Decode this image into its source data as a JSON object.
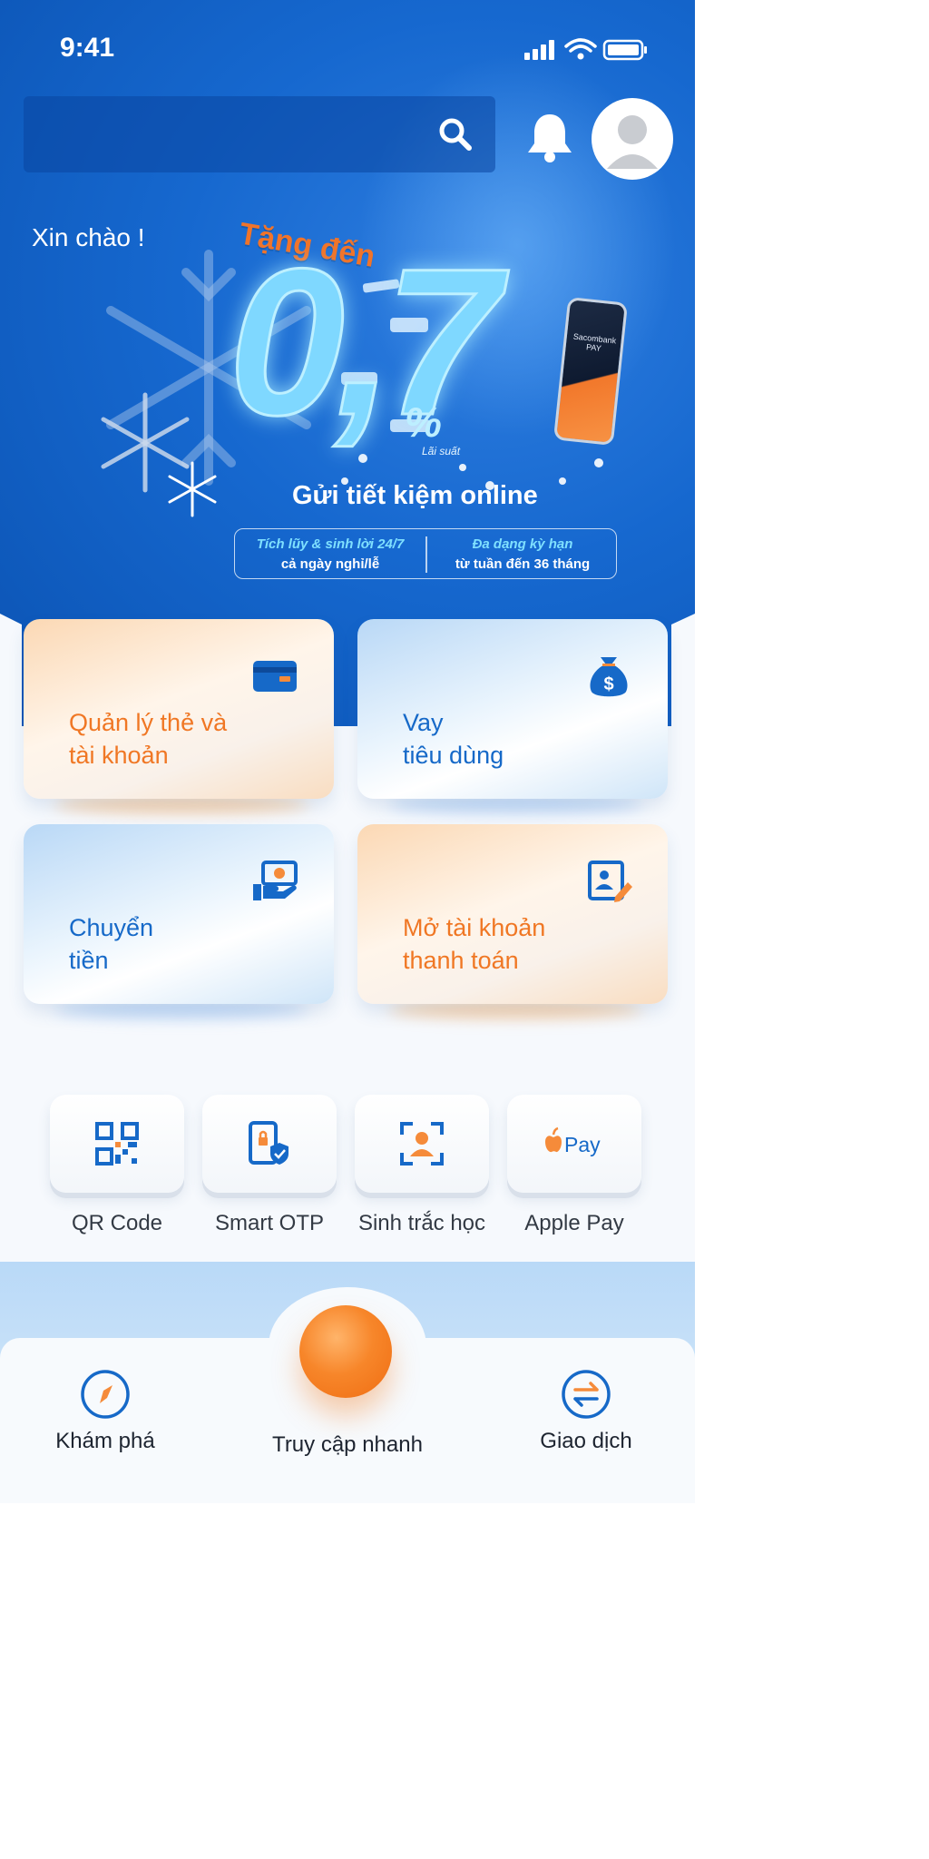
{
  "status_bar": {
    "time": "9:41"
  },
  "header": {
    "greeting": "Xin chào !"
  },
  "banner": {
    "headline": "Tặng đến",
    "rate": "0,7",
    "rate_unit": "%",
    "rate_note": "Lãi suất",
    "title": "Gửi tiết kiệm online",
    "features": [
      {
        "line1": "Tích lũy & sinh lời 24/7",
        "line2": "cả ngày nghỉ/lễ"
      },
      {
        "line1": "Đa dạng kỳ hạn",
        "line2": "từ tuần đến 36 tháng"
      }
    ],
    "phone_label": "Sacombank PAY"
  },
  "cards": [
    {
      "label_line1": "Quản lý thẻ và",
      "label_line2": "tài khoản",
      "icon": "card-icon",
      "color": "#f07724"
    },
    {
      "label_line1": "Vay",
      "label_line2": "tiêu dùng",
      "icon": "money-bag-icon",
      "color": "#1669c8"
    },
    {
      "label_line1": "Chuyển",
      "label_line2": "tiền",
      "icon": "transfer-money-icon",
      "color": "#1669c8"
    },
    {
      "label_line1": "Mở tài khoản",
      "label_line2": "thanh toán",
      "icon": "edit-account-icon",
      "color": "#f07724"
    }
  ],
  "quick_actions": [
    {
      "label": "QR Code",
      "icon": "qr-code-icon"
    },
    {
      "label": "Smart OTP",
      "icon": "smart-otp-icon"
    },
    {
      "label": "Sinh trắc học",
      "icon": "face-scan-icon"
    },
    {
      "label": "Apple Pay",
      "icon": "apple-pay-icon",
      "icon_text": "Pay"
    }
  ],
  "bottom_nav": {
    "items": [
      {
        "label": "Khám phá",
        "icon": "compass-icon"
      },
      {
        "label": "Truy cập nhanh",
        "icon": "quick-access-icon"
      },
      {
        "label": "Giao dịch",
        "icon": "transaction-icon"
      }
    ]
  },
  "colors": {
    "primary_blue": "#1669c8",
    "accent_orange": "#f07724",
    "navy": "#0d4a9a"
  }
}
